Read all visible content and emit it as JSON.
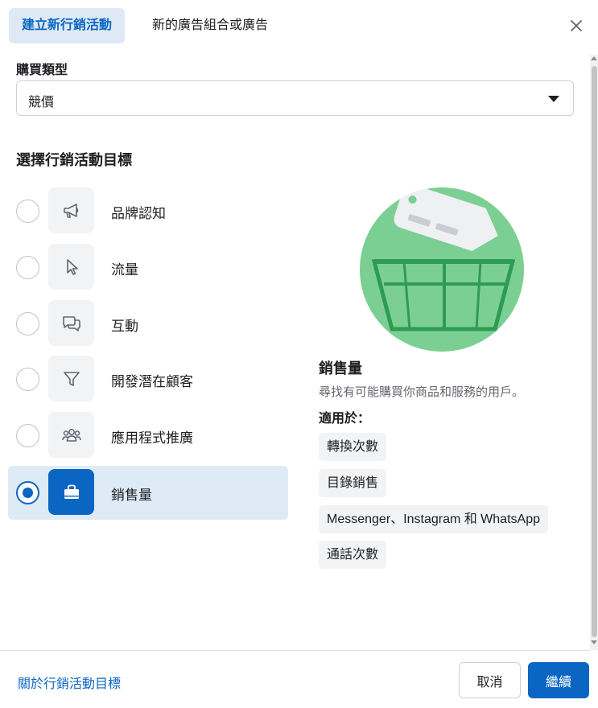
{
  "header": {
    "tabs": [
      {
        "label": "建立新行銷活動",
        "active": true
      },
      {
        "label": "新的廣告組合或廣告",
        "active": false
      }
    ]
  },
  "buying_type": {
    "label": "購買類型",
    "value": "競價"
  },
  "objective_section": {
    "title": "選擇行銷活動目標",
    "options": [
      {
        "label": "品牌認知",
        "icon": "megaphone-icon",
        "selected": false
      },
      {
        "label": "流量",
        "icon": "cursor-icon",
        "selected": false
      },
      {
        "label": "互動",
        "icon": "chat-bubbles-icon",
        "selected": false
      },
      {
        "label": "開發潛在顧客",
        "icon": "funnel-icon",
        "selected": false
      },
      {
        "label": "應用程式推廣",
        "icon": "people-icon",
        "selected": false
      },
      {
        "label": "銷售量",
        "icon": "shopping-bag-icon",
        "selected": true
      }
    ]
  },
  "detail": {
    "title": "銷售量",
    "description": "尋找有可能購買你商品和服務的用戶。",
    "good_for_label": "適用於：",
    "good_for": [
      "轉換次數",
      "目錄銷售",
      "Messenger、Instagram 和 WhatsApp",
      "通話次數"
    ]
  },
  "footer": {
    "link": "關於行銷活動目標",
    "cancel": "取消",
    "continue": "繼續"
  },
  "colors": {
    "accent": "#0a66c2",
    "selected_bg": "#deebf7",
    "illustration_green": "#7ccf93"
  }
}
